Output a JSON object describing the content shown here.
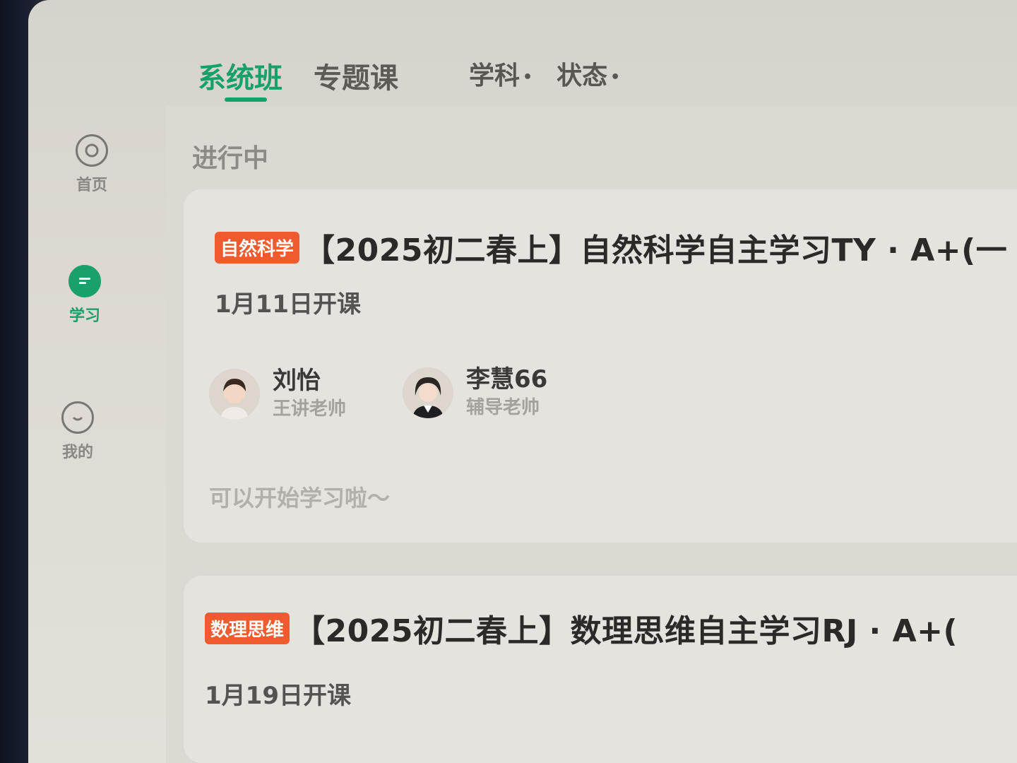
{
  "tabs": [
    {
      "label": "系统班",
      "active": true
    },
    {
      "label": "专题课",
      "active": false
    }
  ],
  "filters": [
    {
      "label": "学科",
      "dot": "•"
    },
    {
      "label": "状态",
      "dot": "•"
    }
  ],
  "sidebar": {
    "items": [
      {
        "label": "首页",
        "icon": "play-circle-icon",
        "active": false
      },
      {
        "label": "学习",
        "icon": "study-icon",
        "active": true
      },
      {
        "label": "我的",
        "icon": "profile-icon",
        "active": false
      }
    ]
  },
  "section": {
    "title": "进行中"
  },
  "courses": [
    {
      "badge": "自然科学",
      "title": "【2025初二春上】自然科学自主学习TY · A+(一",
      "start_date": "1月11日开课",
      "teachers": [
        {
          "name": "刘怡",
          "role": "王讲老帅"
        },
        {
          "name": "李慧66",
          "role": "辅导老帅"
        }
      ],
      "hint": "可以开始学习啦～"
    },
    {
      "badge": "数理思维",
      "title": "【2025初二春上】数理思维自主学习RJ · A+(",
      "start_date": "1月19日开课"
    }
  ],
  "colors": {
    "accent": "#18a06a",
    "badge": "#ef5a2e"
  }
}
